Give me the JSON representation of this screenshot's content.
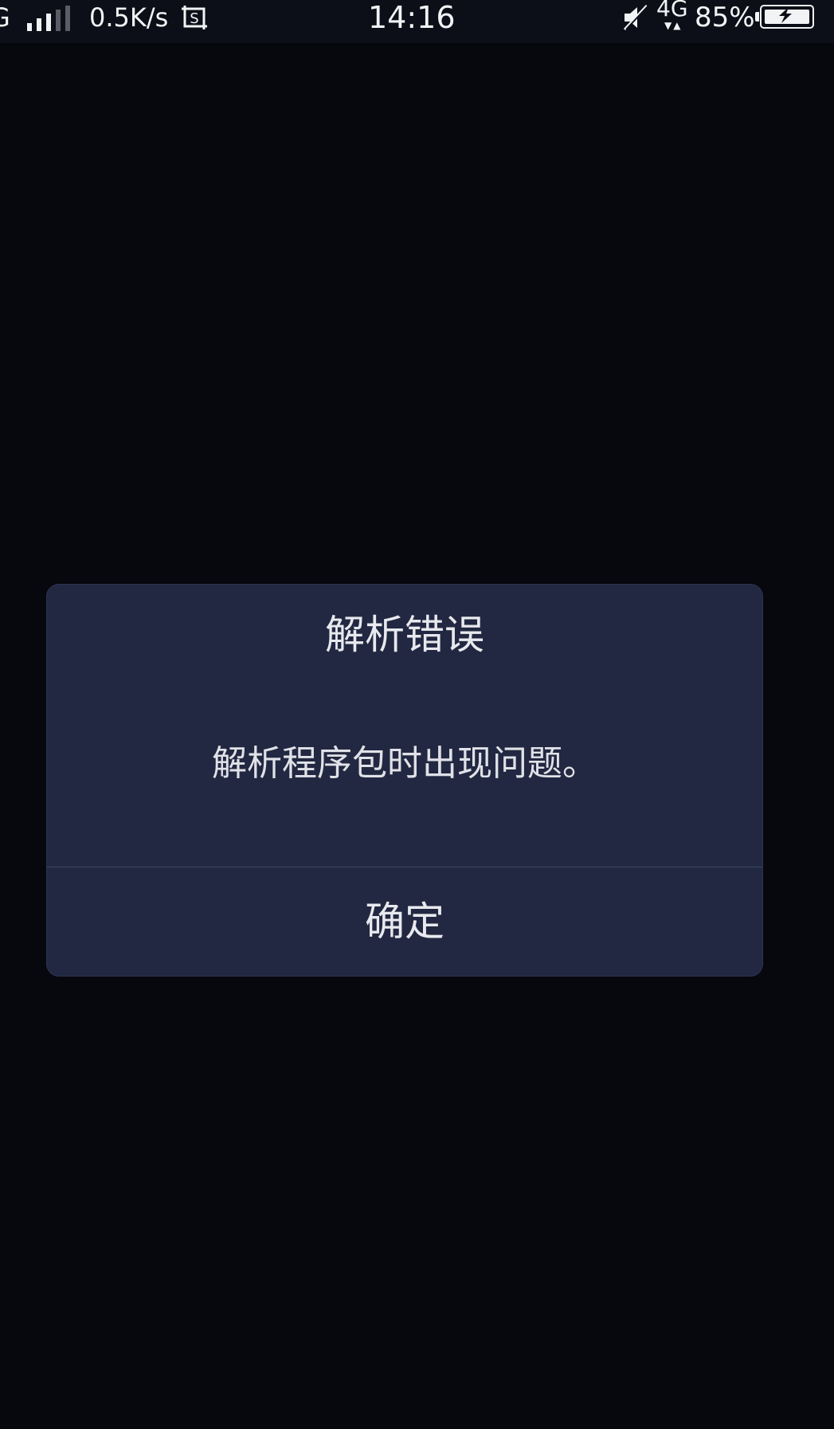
{
  "status_bar": {
    "carrier_fragment": "G",
    "signal_strength_bars": 3,
    "signal_total_bars": 5,
    "net_speed": "0.5K/s",
    "screenshot_icon": "screenshot-icon",
    "time": "14:16",
    "mute_icon": "muted-icon",
    "network_type": "4G",
    "battery_percent": "85%",
    "battery_icon": "battery-charging-icon"
  },
  "dialog": {
    "title": "解析错误",
    "message": "解析程序包时出现问题。",
    "confirm_label": "确定"
  },
  "colors": {
    "background": "#07080d",
    "dialog_bg": "#222841",
    "text": "#e8e9ee"
  }
}
